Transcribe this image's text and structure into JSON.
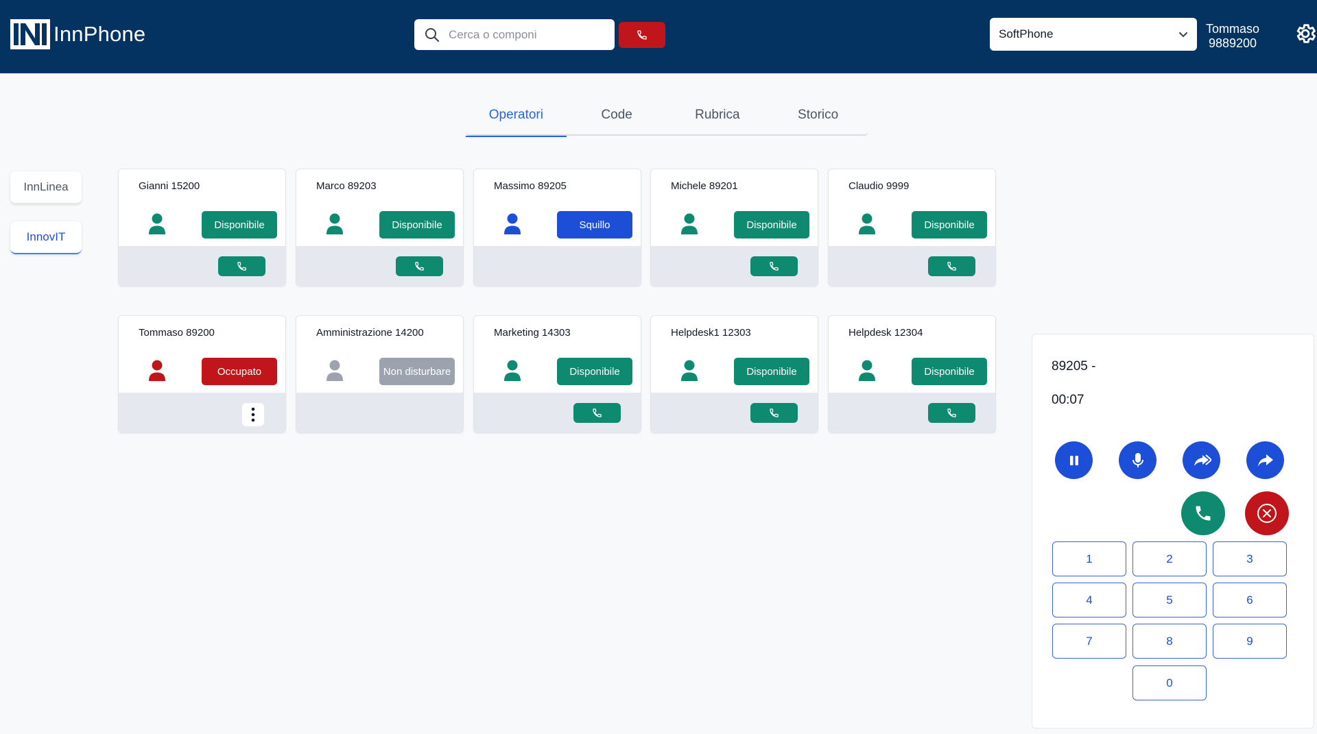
{
  "header": {
    "app_name": "InnPhone",
    "search_placeholder": "Cerca o componi",
    "device_selected": "SoftPhone",
    "user_name": "Tommaso",
    "user_ext": "9889200"
  },
  "tabs": [
    {
      "label": "Operatori",
      "active": true
    },
    {
      "label": "Code",
      "active": false
    },
    {
      "label": "Rubrica",
      "active": false
    },
    {
      "label": "Storico",
      "active": false
    }
  ],
  "groups": [
    {
      "label": "InnLinea",
      "active": false
    },
    {
      "label": "InnovIT",
      "active": true
    }
  ],
  "operators": [
    {
      "name": "Gianni 15200",
      "status": "Disponibile",
      "state": "available",
      "action": "call"
    },
    {
      "name": "Marco 89203",
      "status": "Disponibile",
      "state": "available",
      "action": "call"
    },
    {
      "name": "Massimo 89205",
      "status": "Squillo",
      "state": "ringing",
      "action": "none"
    },
    {
      "name": "Michele 89201",
      "status": "Disponibile",
      "state": "available",
      "action": "call"
    },
    {
      "name": "Claudio 9999",
      "status": "Disponibile",
      "state": "available",
      "action": "call"
    },
    {
      "name": "Tommaso 89200",
      "status": "Occupato",
      "state": "busy",
      "action": "menu"
    },
    {
      "name": "Amministrazione 14200",
      "status": "Non disturbare",
      "state": "dnd",
      "action": "none"
    },
    {
      "name": "Marketing 14303",
      "status": "Disponibile",
      "state": "available",
      "action": "call"
    },
    {
      "name": "Helpdesk1 12303",
      "status": "Disponibile",
      "state": "available",
      "action": "call"
    },
    {
      "name": "Helpdesk 12304",
      "status": "Disponibile",
      "state": "available",
      "action": "call"
    }
  ],
  "call_panel": {
    "number": "89205 -",
    "timer": "00:07",
    "keys": [
      "1",
      "2",
      "3",
      "4",
      "5",
      "6",
      "7",
      "8",
      "9",
      "0"
    ]
  },
  "colors": {
    "header_bg": "#043361",
    "available": "#0e8a70",
    "ringing": "#1d4ed8",
    "busy": "#c0161b",
    "dnd": "#9ca3af",
    "accent": "#2563eb"
  },
  "icons": {
    "search": "search-icon",
    "settings": "gear-icon",
    "call": "phone-icon",
    "person": "person-icon",
    "hold": "pause-icon",
    "mute": "microphone-icon",
    "attended_transfer": "forward-all-icon",
    "blind_transfer": "share-forward-icon",
    "answer": "phone-icon",
    "hangup": "close-circle-icon"
  }
}
